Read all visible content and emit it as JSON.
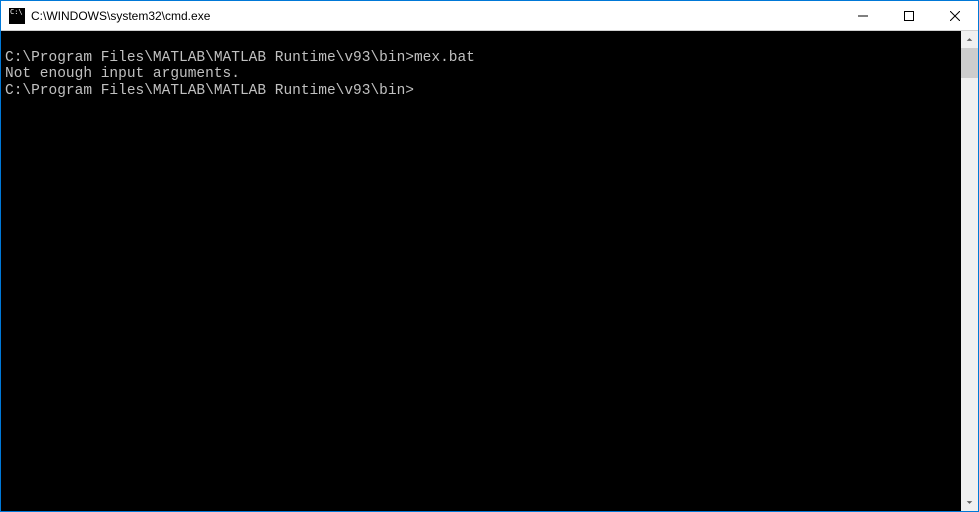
{
  "window": {
    "title": "C:\\WINDOWS\\system32\\cmd.exe"
  },
  "terminal": {
    "line1_prompt": "C:\\Program Files\\MATLAB\\MATLAB Runtime\\v93\\bin>",
    "line1_cmd": "mex.bat",
    "line2": "Not enough input arguments.",
    "line3_prompt": "C:\\Program Files\\MATLAB\\MATLAB Runtime\\v93\\bin>"
  }
}
